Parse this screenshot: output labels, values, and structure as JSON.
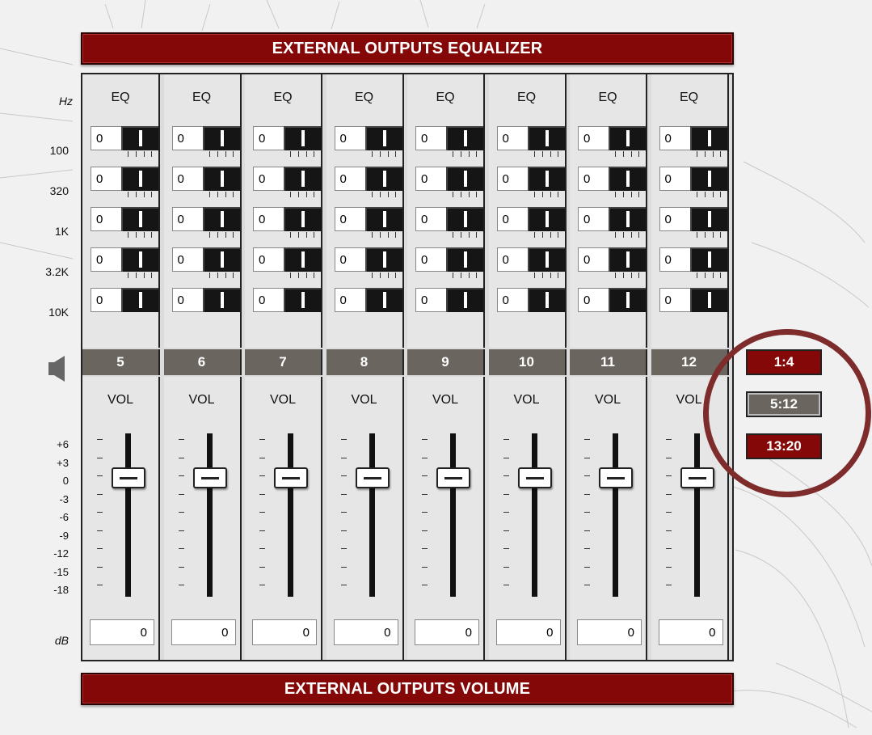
{
  "title": "EXTERNAL OUTPUTS EQUALIZER",
  "footer": "EXTERNAL OUTPUTS VOLUME",
  "hz_label": "Hz",
  "db_label": "dB",
  "bands": [
    "100",
    "320",
    "1K",
    "3.2K",
    "10K"
  ],
  "eq_label": "EQ",
  "vol_label": "VOL",
  "scale": [
    "+6",
    "+3",
    "0",
    "-3",
    "-6",
    "-9",
    "-12",
    "-15",
    "-18"
  ],
  "channels": [
    {
      "num": "5",
      "eq": [
        "0",
        "0",
        "0",
        "0",
        "0"
      ],
      "db": "0"
    },
    {
      "num": "6",
      "eq": [
        "0",
        "0",
        "0",
        "0",
        "0"
      ],
      "db": "0"
    },
    {
      "num": "7",
      "eq": [
        "0",
        "0",
        "0",
        "0",
        "0"
      ],
      "db": "0"
    },
    {
      "num": "8",
      "eq": [
        "0",
        "0",
        "0",
        "0",
        "0"
      ],
      "db": "0"
    },
    {
      "num": "9",
      "eq": [
        "0",
        "0",
        "0",
        "0",
        "0"
      ],
      "db": "0"
    },
    {
      "num": "10",
      "eq": [
        "0",
        "0",
        "0",
        "0",
        "0"
      ],
      "db": "0"
    },
    {
      "num": "11",
      "eq": [
        "0",
        "0",
        "0",
        "0",
        "0"
      ],
      "db": "0"
    },
    {
      "num": "12",
      "eq": [
        "0",
        "0",
        "0",
        "0",
        "0"
      ],
      "db": "0"
    }
  ],
  "banks": [
    {
      "label": "1:4",
      "active": false
    },
    {
      "label": "5:12",
      "active": true
    },
    {
      "label": "13:20",
      "active": false
    }
  ],
  "colors": {
    "header": "#850808",
    "channel_strip": "#6b655f",
    "highlight_circle": "#7d2b2b"
  }
}
